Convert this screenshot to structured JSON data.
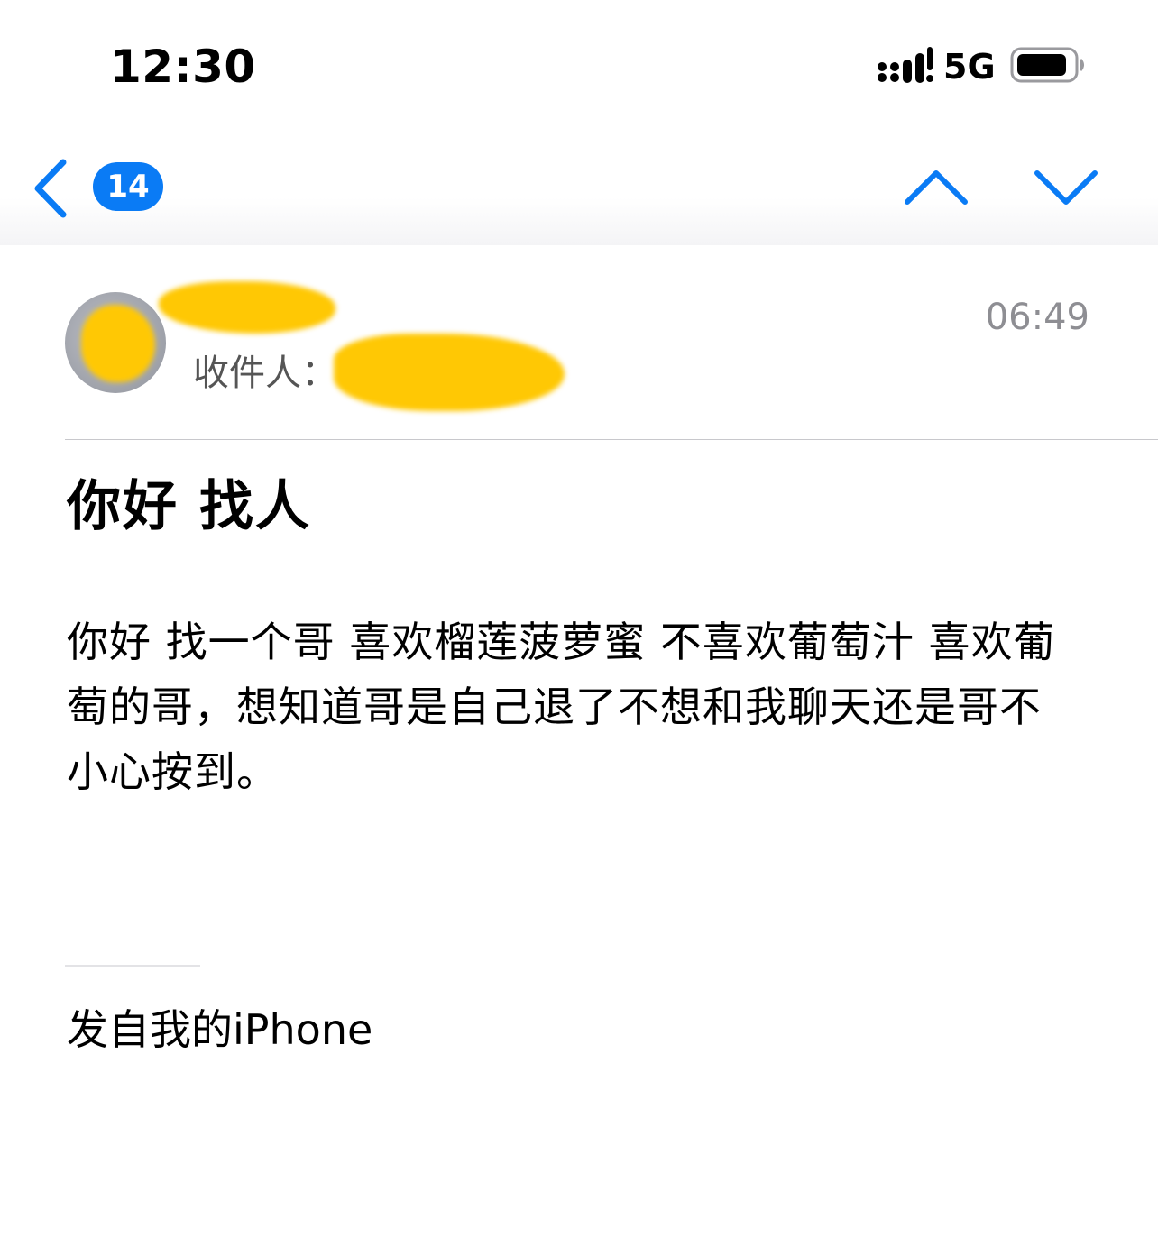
{
  "status_bar": {
    "time": "12:30",
    "network": "5G",
    "icons": [
      "signal-icon",
      "battery-icon"
    ]
  },
  "nav": {
    "unread_count": "14",
    "icons": [
      "chevron-left-icon",
      "chevron-up-icon",
      "chevron-down-icon"
    ],
    "accent_color": "#0a7bf5"
  },
  "message": {
    "sender": "",
    "recipient_label": "收件人：",
    "time": "06:49",
    "subject": "你好 找人",
    "body": "你好 找一个哥 喜欢榴莲菠萝蜜 不喜欢葡萄汁 喜欢葡萄的哥，想知道哥是自己退了不想和我聊天还是哥不小心按到。",
    "signature": "发自我的iPhone"
  },
  "redaction_color": "#ffc804"
}
